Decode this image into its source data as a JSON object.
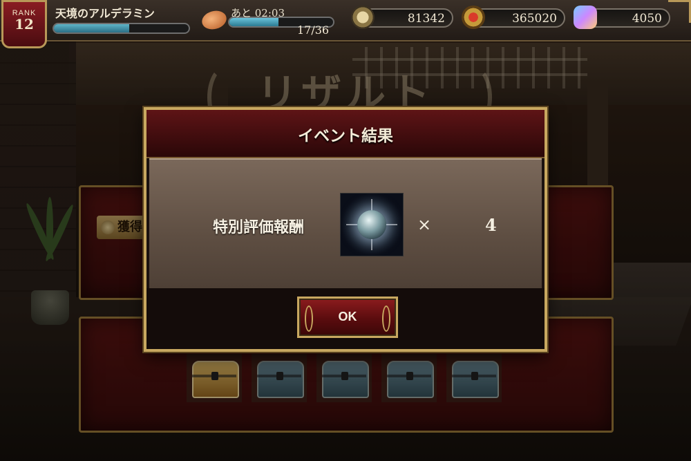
{
  "hud": {
    "rank_label": "RANK",
    "rank_value": "12",
    "player_name": "天境のアルデラミン",
    "exp_progress": 0.56,
    "stamina_timer": "あと 02:03",
    "stamina_count": "17/36",
    "stamina_progress": 0.47,
    "currency_coin": "81342",
    "currency_medal": "365020",
    "currency_gem": "4050"
  },
  "background": {
    "screen_title": "リザルト",
    "gain_tag": "獲得"
  },
  "modal": {
    "title": "イベント結果",
    "reward_label": "特別評価報酬",
    "reward_item_icon": "silver-orb-icon",
    "times_symbol": "×",
    "reward_quantity": "4",
    "ok_label": "OK"
  },
  "chests": [
    "gold",
    "blue",
    "blue",
    "blue",
    "blue"
  ],
  "colors": {
    "frame_gold": "#c8a860",
    "header_red": "#5e1416",
    "button_red": "#8c1c1e"
  }
}
